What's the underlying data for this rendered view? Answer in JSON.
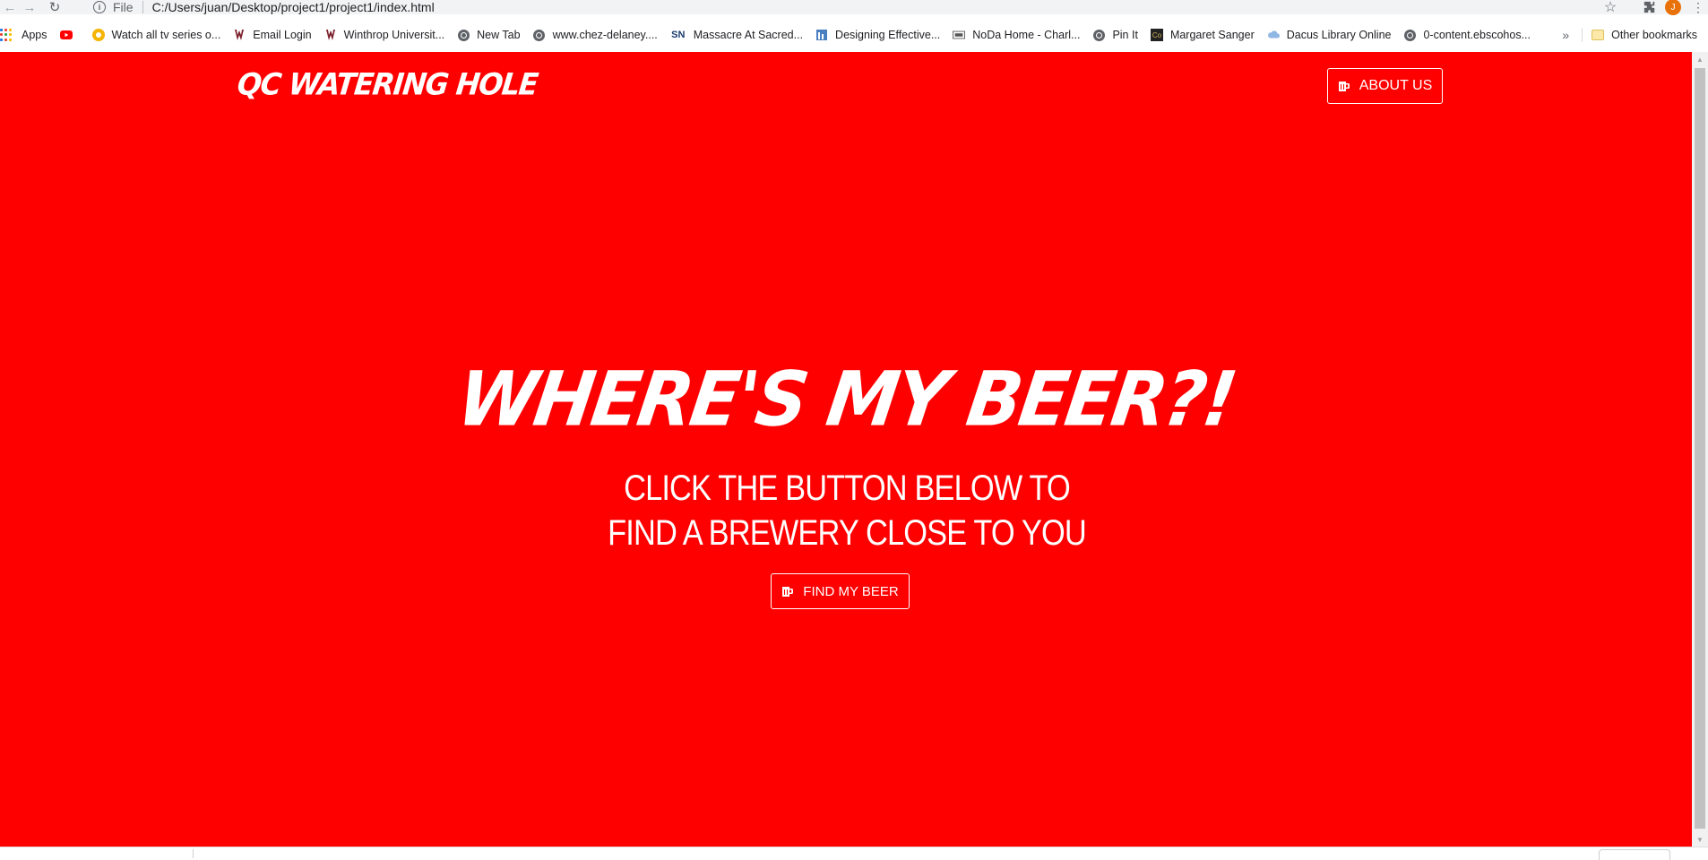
{
  "browser": {
    "scheme_label": "File",
    "url": "C:/Users/juan/Desktop/project1/project1/index.html",
    "profile_initial": "J",
    "bookmarks": [
      {
        "label": "Apps",
        "icon": "apps-grid-icon"
      },
      {
        "label": "",
        "icon": "youtube-icon"
      },
      {
        "label": "Watch all tv series o...",
        "icon": "tv-series-icon"
      },
      {
        "label": "Email Login",
        "icon": "winthrop-icon"
      },
      {
        "label": "Winthrop Universit...",
        "icon": "winthrop-icon"
      },
      {
        "label": "New Tab",
        "icon": "globe-icon"
      },
      {
        "label": "www.chez-delaney....",
        "icon": "globe-icon"
      },
      {
        "label": "Massacre At Sacred...",
        "icon": "sn-icon"
      },
      {
        "label": "Designing Effective...",
        "icon": "document-icon"
      },
      {
        "label": "NoDa Home - Charl...",
        "icon": "noda-icon"
      },
      {
        "label": "Pin It",
        "icon": "globe-icon"
      },
      {
        "label": "Margaret Sanger",
        "icon": "co-icon"
      },
      {
        "label": "Dacus Library Online",
        "icon": "cloud-icon"
      },
      {
        "label": "0-content.ebscohos...",
        "icon": "globe-icon"
      }
    ],
    "other_bookmarks": "Other bookmarks"
  },
  "page": {
    "brand": "QC Watering Hole",
    "about_button": "ABOUT US",
    "hero_title": "Where's My Beer?!",
    "hero_subtitle": "CLICK THE BUTTON BELOW TO FIND A BREWERY CLOSE TO YOU",
    "find_button": "FIND MY BEER",
    "background_color": "#ff0000",
    "text_color": "#ffffff"
  }
}
